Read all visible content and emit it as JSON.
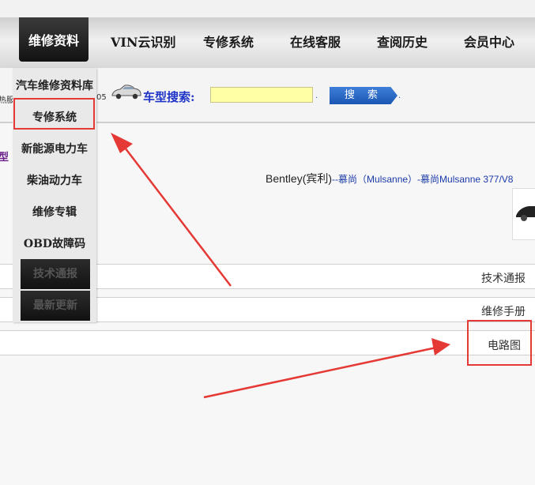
{
  "nav": {
    "items": [
      "维修资料",
      "VIN云识别",
      "专修系统",
      "在线客服",
      "查阅历史",
      "会员中心"
    ]
  },
  "dropdown": {
    "items": [
      "汽车维修资料库",
      "专修系统",
      "新能源电力车",
      "柴油动力车",
      "维修专辑",
      "OBD故障码",
      "技术通报",
      "最新更新"
    ]
  },
  "search": {
    "fragment_left": "热服",
    "fragment_num": "05",
    "label": "车型搜索:",
    "value": "",
    "button": "搜 索",
    "dot1": ".",
    "dot2": "."
  },
  "content": {
    "purple_fragment": "型",
    "vehicle_main": "Bentley(宾利)",
    "vehicle_sub": "--慕尚（Mulsanne）-慕尚Mulsanne 377/V8",
    "rows": [
      "技术通报",
      "维修手册",
      "电路图"
    ]
  },
  "colors": {
    "highlight": "#e53935",
    "search_label": "#1e33c8",
    "search_button": "#1b56b4"
  }
}
